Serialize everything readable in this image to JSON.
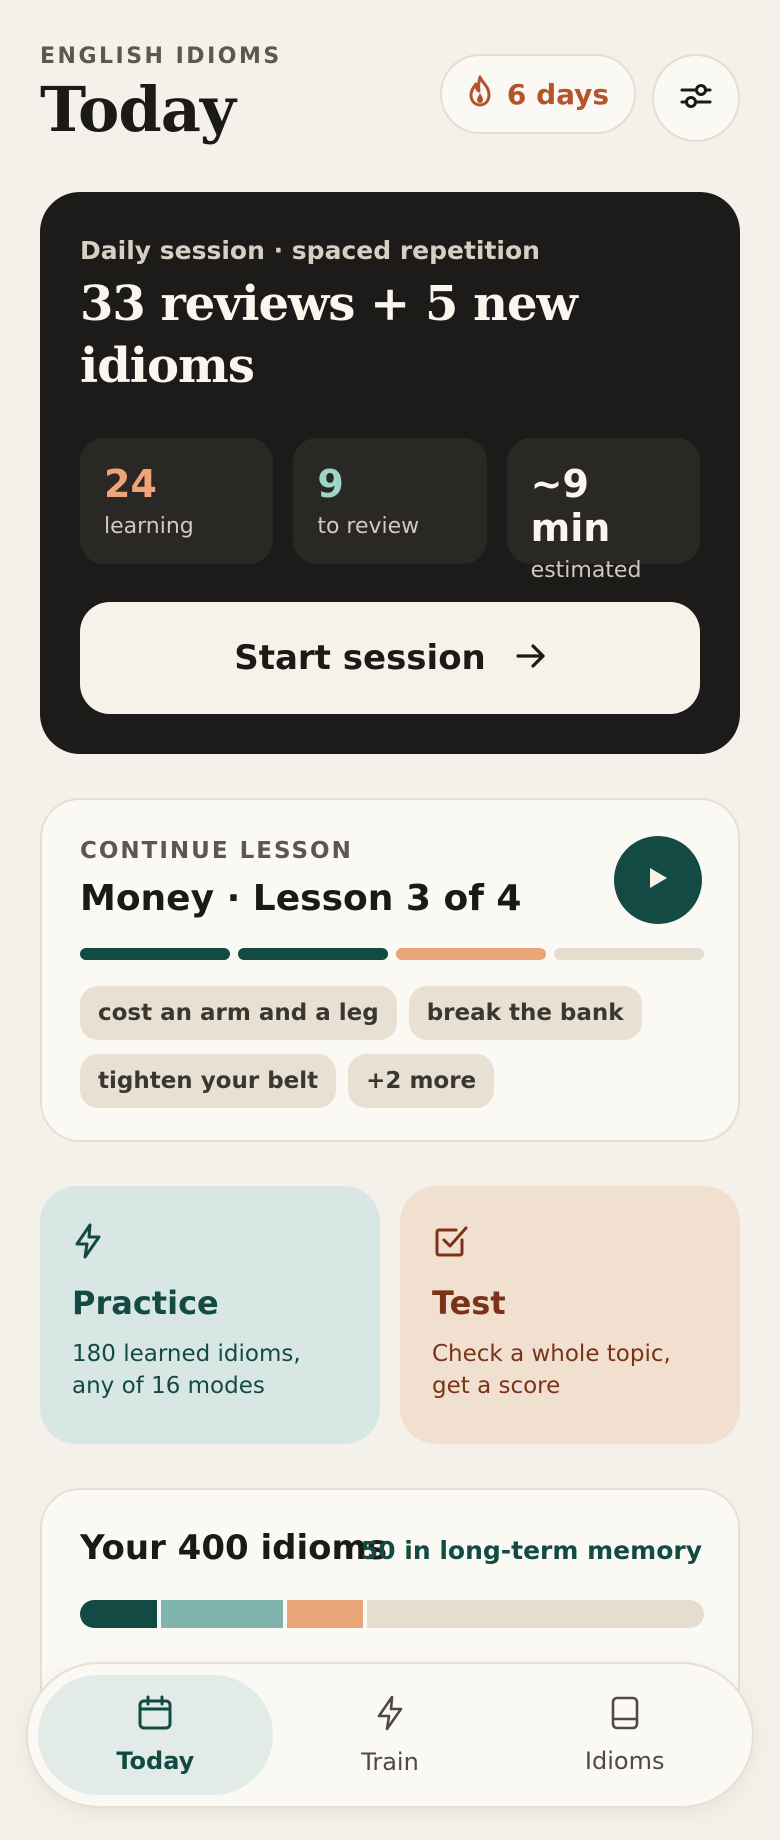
{
  "header": {
    "eyebrow": "ENGLISH IDIOMS",
    "title": "Today",
    "streak_label": "6 days"
  },
  "session": {
    "subtitle": "Daily session · spaced repetition",
    "title": "33 reviews + 5 new idioms",
    "stats": [
      {
        "value": "24",
        "label": "learning",
        "color": "#f0a377"
      },
      {
        "value": "9",
        "label": "to review",
        "color": "#9fd4c9"
      },
      {
        "value": "~9 min",
        "label": "estimated",
        "color": "#faf6ee"
      }
    ],
    "start_label": "Start session"
  },
  "lesson": {
    "eyebrow": "CONTINUE LESSON",
    "title": "Money · Lesson 3 of 4",
    "progress_segments": [
      "#134b44",
      "#134b44",
      "#e8a678",
      "#e4ddd0"
    ],
    "chips": [
      "cost an arm and a leg",
      "break the bank",
      "tighten your belt",
      "+2 more"
    ]
  },
  "practice": {
    "title": "Practice",
    "description": "180 learned idioms, any of 16 modes"
  },
  "test": {
    "title": "Test",
    "description": "Check a whole topic, get a score"
  },
  "summary": {
    "title": "Your 400 idioms",
    "meta": "50 in long-term memory",
    "segments": [
      {
        "count": 50,
        "color": "#134b44"
      },
      {
        "count": 80,
        "color": "#7fb5ad"
      },
      {
        "count": 50,
        "color": "#e8a678"
      },
      {
        "count": 220,
        "color": "#e4ddd0"
      }
    ]
  },
  "nav": {
    "items": [
      {
        "label": "Today",
        "icon": "calendar-icon",
        "active": true
      },
      {
        "label": "Train",
        "icon": "lightning-icon",
        "active": false
      },
      {
        "label": "Idioms",
        "icon": "book-icon",
        "active": false
      }
    ]
  },
  "colors": {
    "accent": "#134b44",
    "streak": "#b5532d",
    "background": "#f4f1ea"
  }
}
